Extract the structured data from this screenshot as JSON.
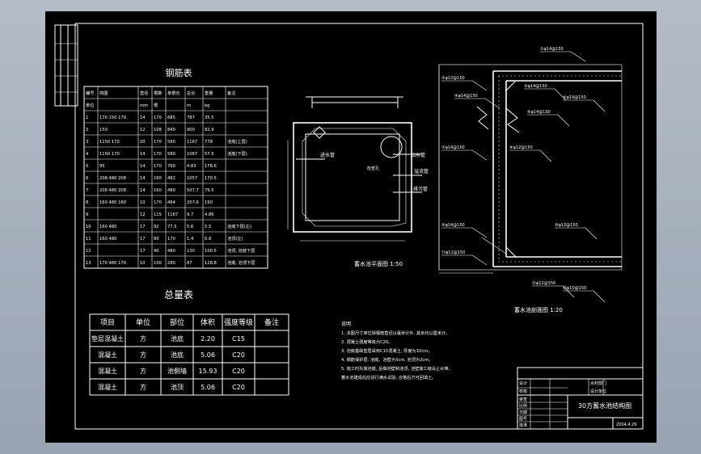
{
  "rebar_table": {
    "title": "钢筋表",
    "headers": [
      "编号",
      "简图",
      "直径",
      "根数",
      "单根长",
      "总长",
      "重量",
      "备注"
    ],
    "sub_headers": [
      "单位",
      "",
      "mm",
      "根",
      "",
      "m",
      "kg",
      ""
    ],
    "rows": [
      [
        "1",
        "170 150 170",
        "14",
        "170",
        "685",
        "787",
        "35.5",
        ""
      ],
      [
        "2",
        "150",
        "12",
        "108",
        "840",
        "900",
        "82.9",
        ""
      ],
      [
        "3",
        "1150 170",
        "20",
        "170",
        "580",
        "1167",
        "778",
        "池底(上层)"
      ],
      [
        "4",
        "1150 170",
        "14",
        "170",
        "580",
        "1067",
        "57.5",
        "池底(下层)"
      ],
      [
        "5",
        "95",
        "14",
        "170",
        "760",
        "4.83",
        "178.6",
        ""
      ],
      [
        "6",
        "208 480 208",
        "14",
        "160",
        "482",
        "1057",
        "170.5",
        ""
      ],
      [
        "7",
        "208 480 208",
        "14",
        "160",
        "480",
        "507.7",
        "79.5",
        ""
      ],
      [
        "8",
        "160 480 160",
        "10",
        "170",
        "484",
        "207.6",
        "150",
        ""
      ],
      [
        "9",
        "",
        "12",
        "115",
        "1167",
        "9.7",
        "4.86",
        ""
      ],
      [
        "10",
        "160 480",
        "17",
        "92",
        "77.5",
        "5.6",
        "5.5",
        "池底下层(左)"
      ],
      [
        "11",
        "160 480",
        "17",
        "80",
        "170",
        "1.4",
        "0.8",
        "池顶(左)"
      ],
      [
        "12",
        "",
        "17",
        "40",
        "480",
        "130",
        "100.5",
        "池顶, 池底下层"
      ],
      [
        "13",
        "170 480 170",
        "10",
        "100",
        "280",
        "87",
        "128.8",
        "池底, 池顶下层"
      ]
    ]
  },
  "summary_table": {
    "title": "总量表",
    "headers": [
      "项目",
      "单位",
      "部位",
      "体积",
      "强度等级",
      "备注"
    ],
    "rows": [
      [
        "垫层混凝土",
        "方",
        "池底",
        "2.20",
        "C15",
        ""
      ],
      [
        "混凝土",
        "方",
        "池底",
        "5.06",
        "C20",
        ""
      ],
      [
        "混凝土",
        "方",
        "池侧墙",
        "15.93",
        "C20",
        ""
      ],
      [
        "混凝土",
        "方",
        "池顶",
        "5.06",
        "C20",
        ""
      ]
    ]
  },
  "plan_view": {
    "caption": "蓄水池平面图 1:50",
    "labels": [
      "进水管",
      "出水管",
      "溢流管",
      "排污管",
      "检查孔"
    ]
  },
  "section_view": {
    "caption": "蓄水池剖面图 1:20",
    "callouts": [
      "①φ14@150",
      "②φ12@150",
      "③φ14@150",
      "④φ14@150",
      "⑤φ14@150",
      "⑥φ14@150",
      "⑦φ14@150",
      "⑧φ12@150",
      "⑨φ14@150",
      "⑩φ12@150",
      "⑪φ12@150",
      "⑫φ12@150",
      "⑬φ10@150"
    ]
  },
  "notes": {
    "heading": "说明",
    "items": [
      "1. 本图尺寸单位除钢筋直径以毫米计外, 其余均以厘米计。",
      "2. 混凝土强度等级为C20。",
      "3. 池底基础垫层采用C15混凝土, 厚度为10cm。",
      "4. 钢筋保护层: 池底、池壁为3cm, 池顶为2cm。",
      "5. 施工时先做池底, 后做池壁和池顶, 池壁施工缝设止水带。",
      "   蓄水池建成后应进行满水试验, 合格后方可回填土。"
    ]
  },
  "title_block": {
    "drawing_title": "30方蓄水池结构图",
    "left_labels": [
      "设计",
      "校核",
      "审查",
      "比例",
      "日期",
      "图号",
      "批准"
    ],
    "right_labels": [
      "水利部门",
      "设计单位"
    ],
    "date": "2004.4.29"
  },
  "colors": {
    "background": "#000000",
    "line": "#ffffff",
    "viewport": "#a9b2bf"
  }
}
